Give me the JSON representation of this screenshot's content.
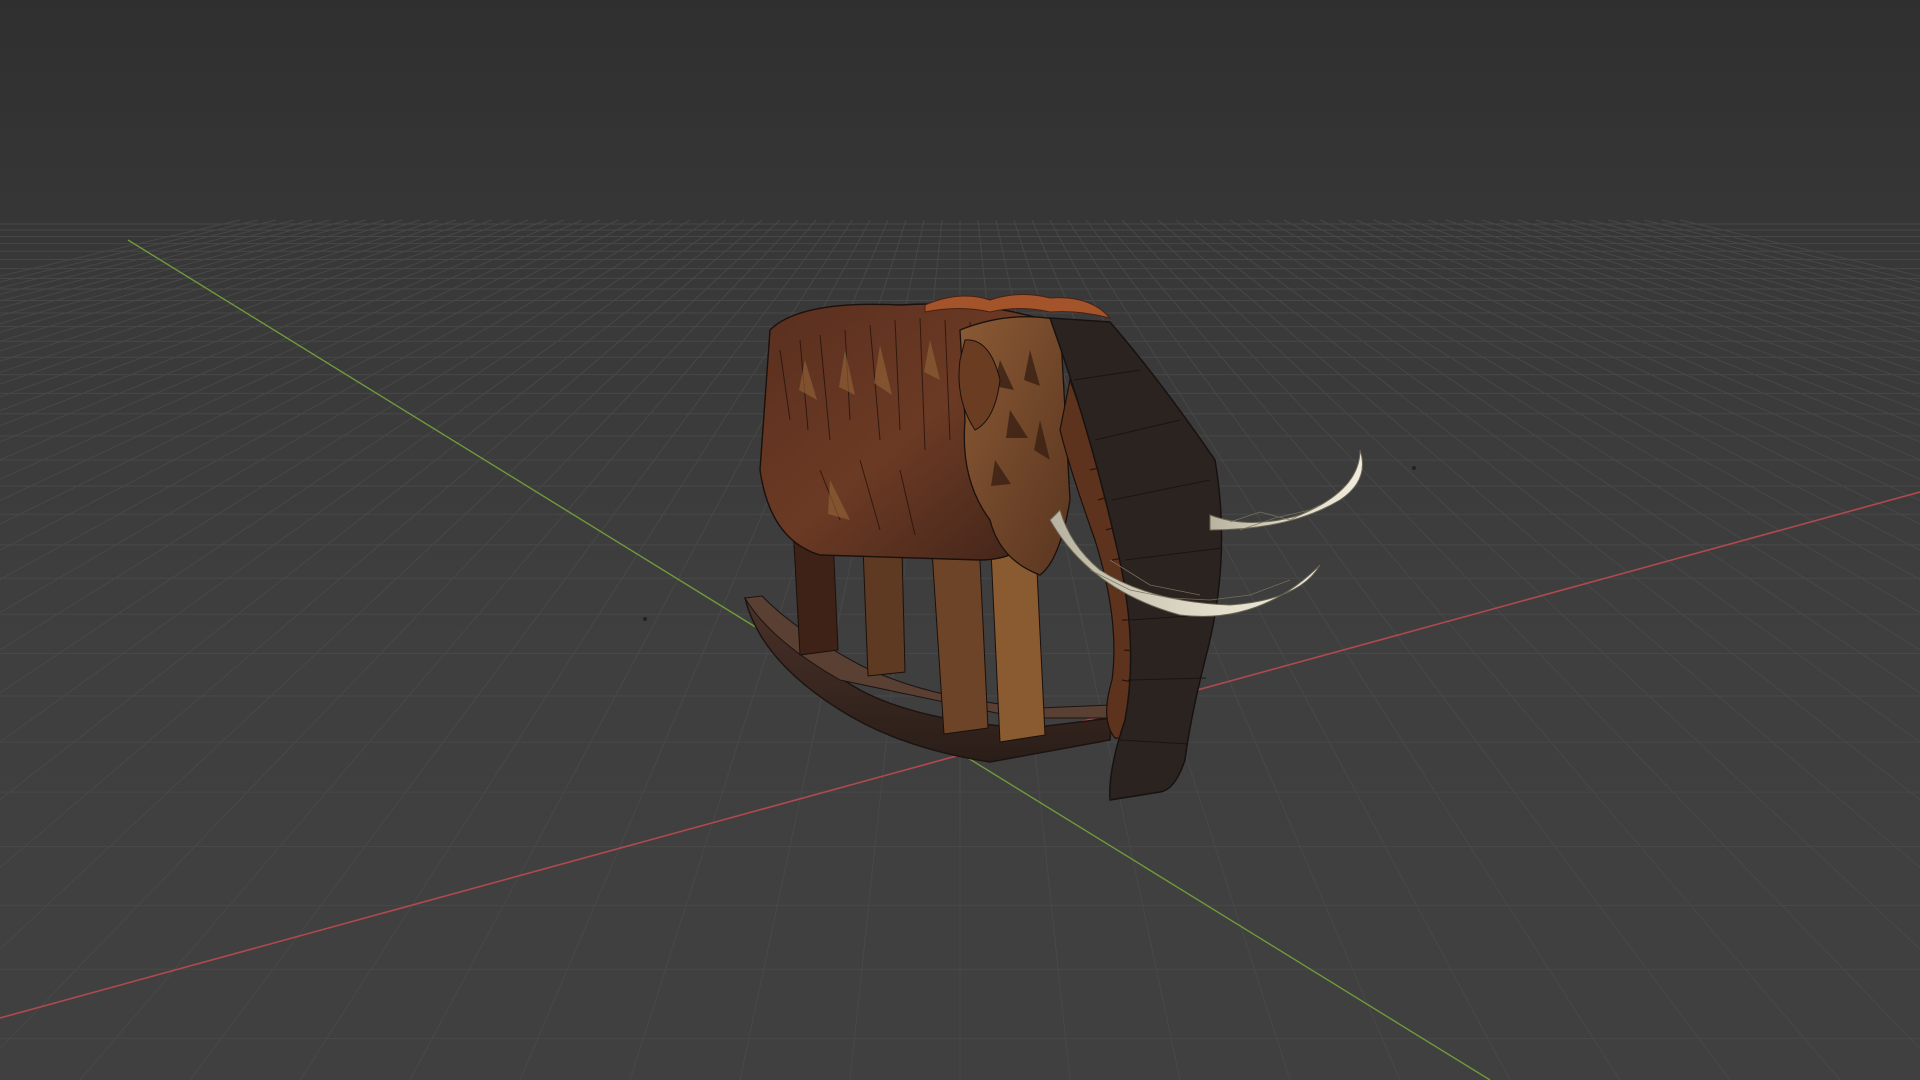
{
  "viewport": {
    "background_color": "#3d3d3d",
    "grid_line_color": "#4a4a4a",
    "x_axis_color": "#b0494f",
    "y_axis_color": "#6f9a3a"
  },
  "scene": {
    "object": "rocking-mammoth-mesh",
    "shading": "wireframe-over-solid",
    "tusk_color": "#d8d2bf",
    "fur_color": "#6b3a24",
    "rocker_color": "#3a2a24"
  }
}
